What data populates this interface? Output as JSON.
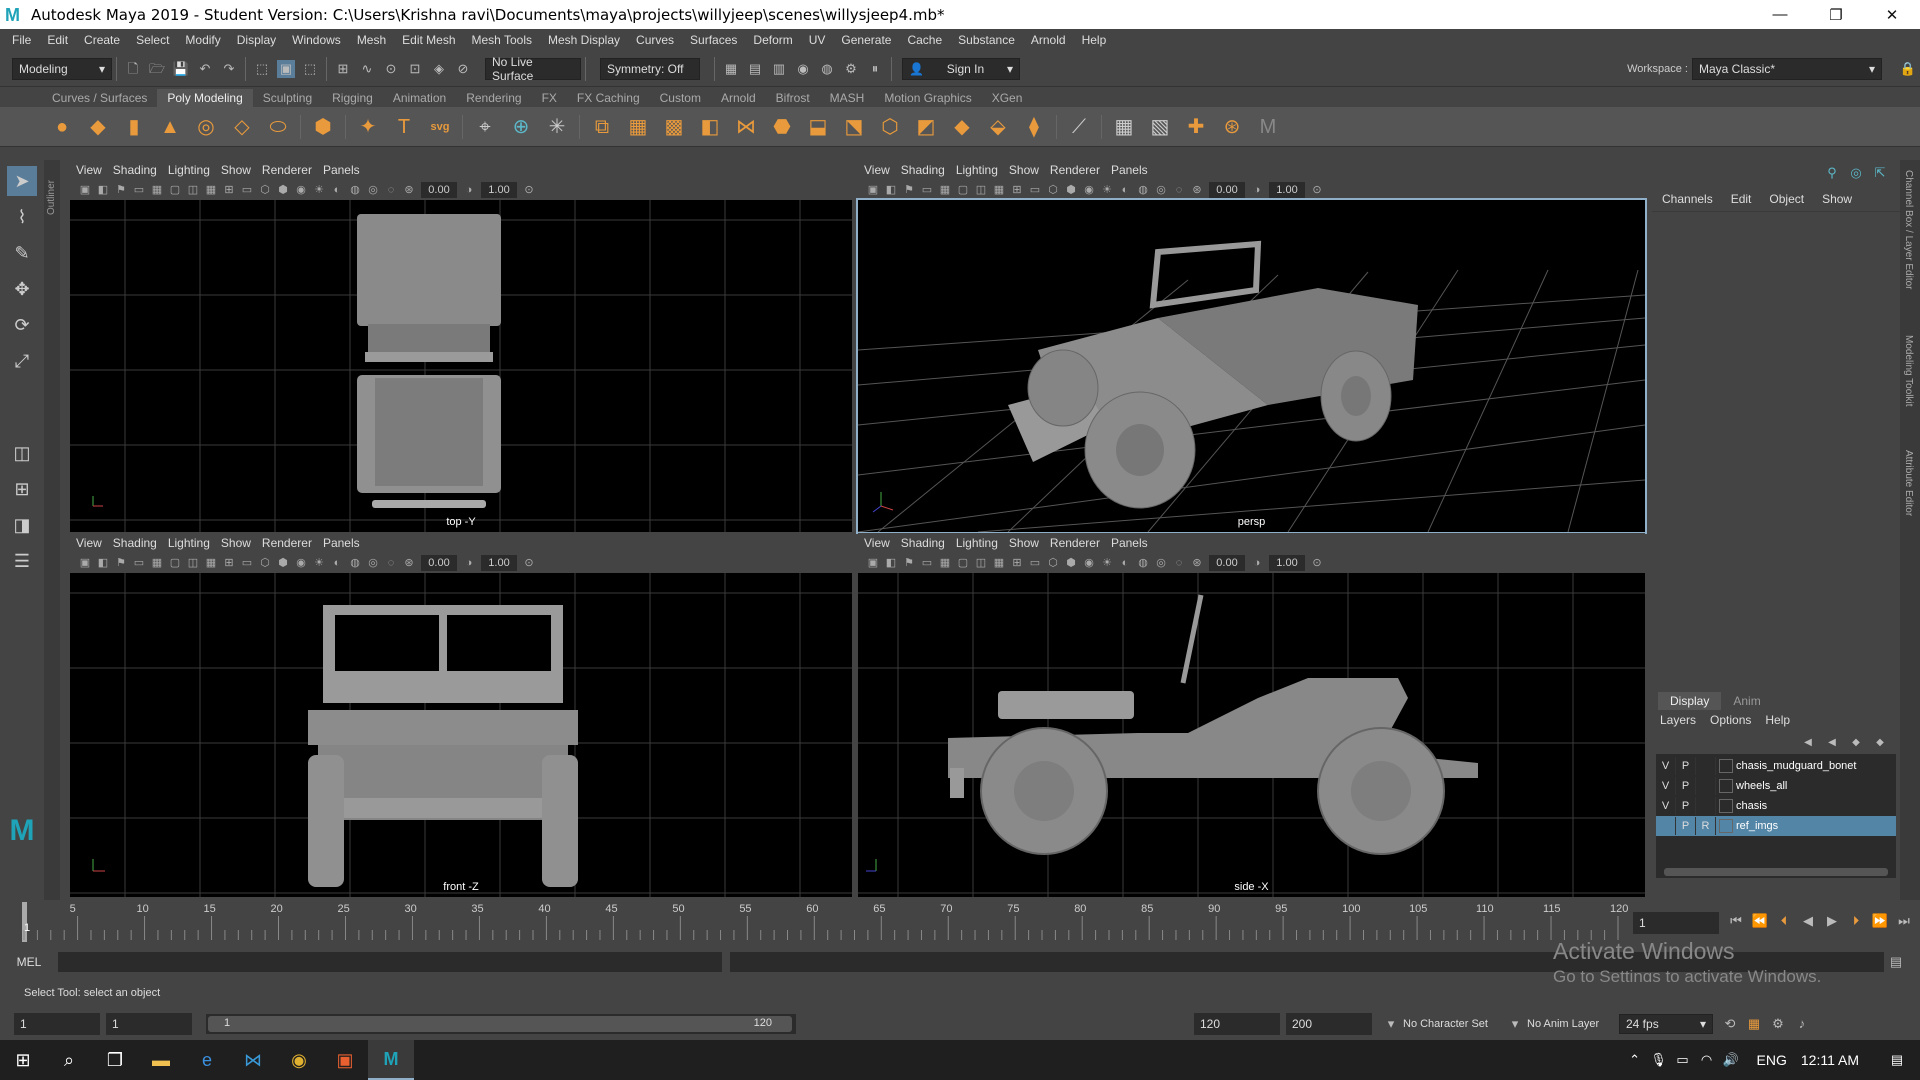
{
  "window": {
    "title": "Autodesk Maya 2019 - Student Version: C:\\Users\\Krishna ravi\\Documents\\maya\\projects\\willyjeep\\scenes\\willysjeep4.mb*"
  },
  "menubar": [
    "File",
    "Edit",
    "Create",
    "Select",
    "Modify",
    "Display",
    "Windows",
    "Mesh",
    "Edit Mesh",
    "Mesh Tools",
    "Mesh Display",
    "Curves",
    "Surfaces",
    "Deform",
    "UV",
    "Generate",
    "Cache",
    "Substance",
    "Arnold",
    "Help"
  ],
  "status": {
    "mode": "Modeling",
    "live_surface": "No Live Surface",
    "symmetry": "Symmetry: Off",
    "sign_in": "Sign In",
    "workspace_label": "Workspace :",
    "workspace": "Maya Classic*"
  },
  "shelf_tabs": [
    "Curves / Surfaces",
    "Poly Modeling",
    "Sculpting",
    "Rigging",
    "Animation",
    "Rendering",
    "FX",
    "FX Caching",
    "Custom",
    "Arnold",
    "Bifrost",
    "MASH",
    "Motion Graphics",
    "XGen"
  ],
  "panel_menu": [
    "View",
    "Shading",
    "Lighting",
    "Show",
    "Renderer",
    "Panels"
  ],
  "panel_fields": {
    "a": "0.00",
    "b": "1.00"
  },
  "viewports": {
    "top": "top -Y",
    "persp": "persp",
    "front": "front -Z",
    "side": "side -X"
  },
  "outliner_label": "Outliner",
  "channel_menu": [
    "Channels",
    "Edit",
    "Object",
    "Show"
  ],
  "side_tabs": [
    "Channel Box / Layer Editor",
    "Modeling Toolkit",
    "Attribute Editor"
  ],
  "layer_tabs": [
    "Display",
    "Anim"
  ],
  "layer_menu": [
    "Layers",
    "Options",
    "Help"
  ],
  "layers": [
    {
      "v": "V",
      "p": "P",
      "r": "",
      "name": "chasis_mudguard_bonet",
      "selected": false
    },
    {
      "v": "V",
      "p": "P",
      "r": "",
      "name": "wheels_all",
      "selected": false
    },
    {
      "v": "V",
      "p": "P",
      "r": "",
      "name": "chasis",
      "selected": false
    },
    {
      "v": "",
      "p": "P",
      "r": "R",
      "name": "ref_imgs",
      "selected": true
    }
  ],
  "timeline": {
    "ticks": [
      "5",
      "10",
      "15",
      "20",
      "25",
      "30",
      "35",
      "40",
      "45",
      "50",
      "55",
      "60",
      "65",
      "70",
      "75",
      "80",
      "85",
      "90",
      "95",
      "100",
      "105",
      "110",
      "115",
      "120"
    ],
    "start_marker": "1",
    "current_frame": "1"
  },
  "cmd": {
    "lang": "MEL"
  },
  "help_text": "Select Tool: select an object",
  "range": {
    "start": "1",
    "anim_start": "1",
    "slider_start": "1",
    "slider_end": "120",
    "end": "120",
    "anim_end": "200",
    "char_set": "No Character Set",
    "anim_layer": "No Anim Layer",
    "fps": "24 fps"
  },
  "activate": {
    "line1": "Activate Windows",
    "line2": "Go to Settings to activate Windows."
  },
  "taskbar": {
    "lang": "ENG",
    "time": "12:11 AM"
  }
}
